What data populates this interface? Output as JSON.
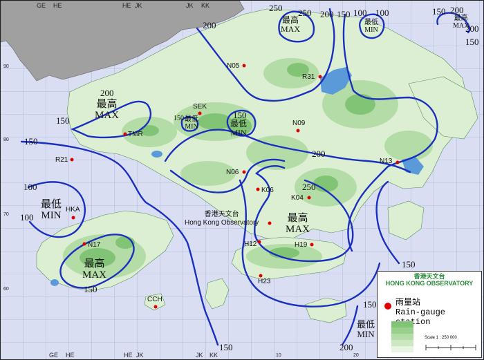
{
  "grid_labels": {
    "top": [
      "GE",
      "HE",
      "HE",
      "JK",
      "JK",
      "KK"
    ],
    "bottom": [
      "GE",
      "HE",
      "HE",
      "JK",
      "JK",
      "KK"
    ],
    "left_ticks": [
      "90",
      "80",
      "70",
      "60"
    ],
    "bottom_ticks": [
      "10",
      "20"
    ]
  },
  "isohyets": [
    {
      "label": "250"
    },
    {
      "label": "250"
    },
    {
      "label": "200"
    },
    {
      "label": "150"
    },
    {
      "label": "100"
    },
    {
      "label": "100"
    },
    {
      "label": "150"
    },
    {
      "label": "200"
    },
    {
      "label": "200"
    },
    {
      "label": "150"
    },
    {
      "label": "200"
    },
    {
      "label": "200"
    },
    {
      "label": "150"
    },
    {
      "label": "150"
    },
    {
      "label": "150"
    },
    {
      "label": "200"
    },
    {
      "label": "250"
    },
    {
      "label": "100"
    },
    {
      "label": "100"
    },
    {
      "label": "150"
    },
    {
      "label": "150"
    },
    {
      "label": "150"
    },
    {
      "label": "150"
    }
  ],
  "extrema": [
    {
      "zh": "最高",
      "en": "MAX"
    },
    {
      "zh": "最低",
      "en": "MIN"
    },
    {
      "zh": "最高",
      "en": "MAX"
    },
    {
      "zh": "最高",
      "en": "MAX"
    },
    {
      "zh": "最低",
      "en": "MIN"
    },
    {
      "zh": "最低",
      "en": "MIN"
    },
    {
      "zh": "最低",
      "en": "MIN"
    },
    {
      "zh": "最高",
      "en": "MAX"
    },
    {
      "zh": "最高",
      "en": "MAX"
    },
    {
      "zh": "最低",
      "en": "MIN"
    }
  ],
  "stations": [
    {
      "id": "N05"
    },
    {
      "id": "R31"
    },
    {
      "id": "SEK"
    },
    {
      "id": "N09"
    },
    {
      "id": "TMR"
    },
    {
      "id": "R21"
    },
    {
      "id": "N06"
    },
    {
      "id": "K06"
    },
    {
      "id": "N13"
    },
    {
      "id": "K04"
    },
    {
      "id": "HKA"
    },
    {
      "id": "N17"
    },
    {
      "id": "H12"
    },
    {
      "id": "H19"
    },
    {
      "id": "H23"
    },
    {
      "id": "CCH"
    }
  ],
  "observatory": {
    "zh": "香港天文台",
    "en": "Hong Kong Observatory"
  },
  "legend": {
    "org_zh": "香港天文台",
    "org_en": "HONG KONG OBSERVATORY",
    "station_zh": "雨量站",
    "station_en": "Rain-gauge station",
    "scale": "Scale 1 : 250 000"
  },
  "colors": {
    "sea": "#d9def2",
    "mainland": "#a0a0a0",
    "land_low": "#dcefd2",
    "land_mid": "#b4dca6",
    "land_high": "#82c476",
    "reservoir": "#5a9ad8",
    "isohyet": "#1a2fbf",
    "station": "#e00000"
  }
}
